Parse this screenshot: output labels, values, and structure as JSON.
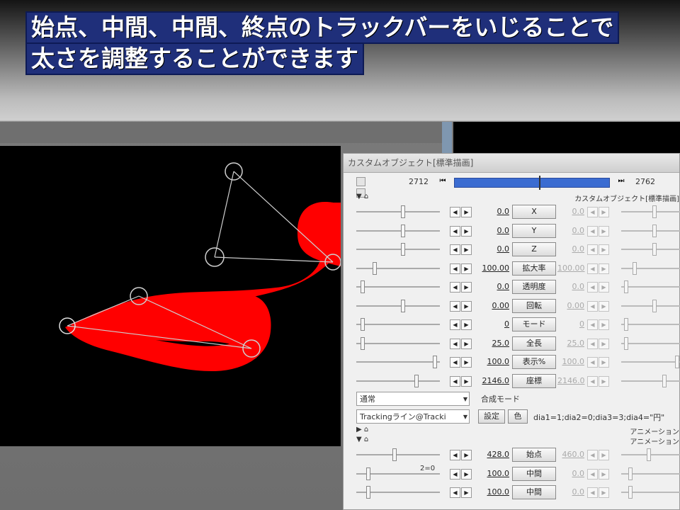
{
  "caption": {
    "line1": "始点、中間、中間、終点のトラックバーをいじることで",
    "line2": "太さを調整することができます"
  },
  "dialog": {
    "title": "カスタムオブジェクト[標準描画]",
    "frame_start": "2712",
    "frame_end": "2762",
    "timeline_progress": 0.55,
    "section_label": "カスタムオブジェクト[標準描画]",
    "params": [
      {
        "label": "X",
        "value": "0.0",
        "value2": "0.0",
        "knob": 0.55
      },
      {
        "label": "Y",
        "value": "0.0",
        "value2": "0.0",
        "knob": 0.55
      },
      {
        "label": "Z",
        "value": "0.0",
        "value2": "0.0",
        "knob": 0.55
      },
      {
        "label": "拡大率",
        "value": "100.00",
        "value2": "100.00",
        "knob": 0.2
      },
      {
        "label": "透明度",
        "value": "0.0",
        "value2": "0.0",
        "knob": 0.05
      },
      {
        "label": "回転",
        "value": "0.00",
        "value2": "0.00",
        "knob": 0.55
      },
      {
        "label": "モード",
        "value": "0",
        "value2": "0",
        "knob": 0.05
      },
      {
        "label": "全長",
        "value": "25.0",
        "value2": "25.0",
        "knob": 0.05
      },
      {
        "label": "表示%",
        "value": "100.0",
        "value2": "100.0",
        "knob": 0.95
      },
      {
        "label": "座標",
        "value": "2146.0",
        "value2": "2146.0",
        "knob": 0.72
      }
    ],
    "blend_select": "通常",
    "blend_label": "合成モード",
    "script_select": "Trackingライン@Tracki",
    "settings_button": "設定",
    "color_button": "色",
    "script_params": "dia1=1;dia2=0;dia3=3;dia4=\"円\"",
    "anim_label_1": "アニメーション",
    "anim_label_2": "アニメーション",
    "anim_params": [
      {
        "label": "始点",
        "value": "428.0",
        "value2": "460.0",
        "knob": 0.45
      },
      {
        "label": "中間",
        "value": "100.0",
        "value2": "0.0",
        "knob": 0.12,
        "note": "2=0"
      },
      {
        "label": "中間",
        "value": "100.0",
        "value2": "0.0",
        "knob": 0.12
      }
    ]
  }
}
